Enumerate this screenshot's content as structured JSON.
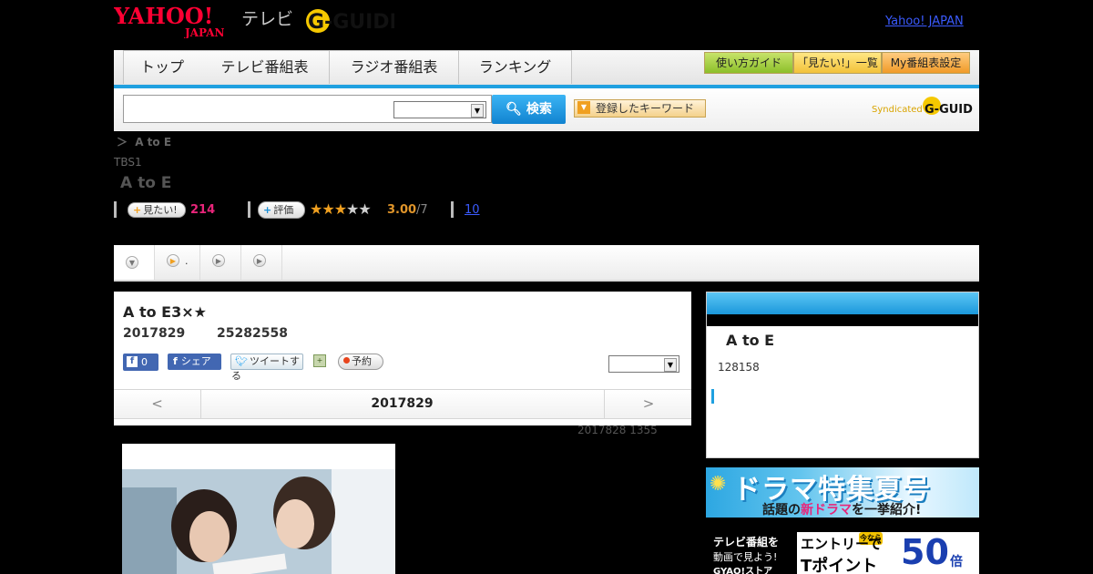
{
  "header": {
    "yahoo_logo": "YAHOO!",
    "yahoo_logo_sub": "JAPAN",
    "tv_label": "テレビ",
    "gguide_logo": "G-GUIDE",
    "yahoo_japan_link": "Yahoo! JAPAN"
  },
  "nav": {
    "tabs": [
      "トップ",
      "テレビ番組表",
      "ラジオ番組表",
      "ランキング"
    ],
    "guide_button": "使い方ガイド",
    "mitai_list_button": "「見たい!」一覧",
    "my_settings_button": "My番組表設定"
  },
  "search": {
    "input_value": "",
    "select_value": "",
    "button_label": "検索",
    "keyword_button": "登録したキーワード",
    "syndicated_label": "Syndicated",
    "syndicated_logo": "G-GUIDE"
  },
  "breadcrumb": {
    "separator": "＞",
    "current": "A to E"
  },
  "program": {
    "channel": "TBS1",
    "title": "A to E",
    "mitai_label": "見たい!",
    "mitai_count": "214",
    "hyoka_label": "評価",
    "rating": "3.00",
    "rating_total": "/7",
    "review_link": "10",
    "stars": {
      "filled": 3,
      "total": 5
    }
  },
  "episode": {
    "title": "A to E3×★",
    "date": "2017829",
    "time": "25282558",
    "fb_like_count": "0",
    "fb_share_label": "シェア",
    "tweet_label": "ツイートする",
    "yoyaku_label": "予約",
    "episode_select_value": "",
    "prev": "<",
    "nav_date": "2017829",
    "next": ">",
    "updated": "2017828  1355"
  },
  "side": {
    "title": "A to E",
    "number": "128158"
  },
  "banners": {
    "drama_title": "ドラマ特集夏号",
    "drama_sub_pre": "話題の",
    "drama_sub_new": "新ドラマ",
    "drama_sub_post": "を一挙紹介!",
    "gyao_l1": "テレビ番組を",
    "gyao_l2": "動画で見よう!",
    "gyao_l3": "GYAO!ストア",
    "gyao_badge": "今なら",
    "gyao_entry": "エントリーで",
    "gyao_tpoint": "Tポイント",
    "gyao_big": "50",
    "gyao_bai": "倍"
  },
  "colors": {
    "accent_blue": "#1fa0e0",
    "mitai_pink": "#e8257a",
    "rating_orange": "#e0952a",
    "star_gold": "#f0a020",
    "facebook": "#4267b2"
  }
}
